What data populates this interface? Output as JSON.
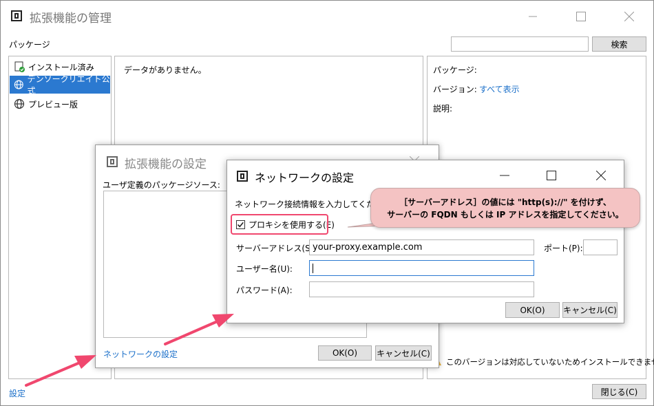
{
  "main_window": {
    "title": "拡張機能の管理",
    "packages_label": "パッケージ",
    "search_button": "検索",
    "sources": [
      {
        "label": "インストール済み",
        "icon": "installed-icon",
        "selected": false
      },
      {
        "label": "デンソークリエイト公式",
        "icon": "globe-icon",
        "selected": true
      },
      {
        "label": "プレビュー版",
        "icon": "globe-icon",
        "selected": false
      }
    ],
    "empty_message": "データがありません。",
    "detail": {
      "package_label": "パッケージ:",
      "version_label": "バージョン:",
      "show_all_link": "すべて表示",
      "description_label": "説明:",
      "warning_text": "このバージョンは対応していないためインストールできません。"
    },
    "settings_link": "設定",
    "close_button": "閉じる(C)"
  },
  "ext_settings": {
    "title": "拡張機能の設定",
    "user_sources_label": "ユーザ定義のパッケージソース:",
    "network_link": "ネットワークの設定",
    "ok_button": "OK(O)",
    "cancel_button": "キャンセル(C)"
  },
  "network_dialog": {
    "title": "ネットワークの設定",
    "instruction": "ネットワーク接続情報を入力してください。",
    "use_proxy_label": "プロキシを使用する(E)",
    "use_proxy_checked": true,
    "server_label": "サーバーアドレス(S):",
    "server_value": "your-proxy.example.com",
    "port_label": "ポート(P):",
    "port_value": "",
    "username_label": "ユーザー名(U):",
    "username_value": "",
    "password_label": "パスワード(A):",
    "password_value": "",
    "ok_button": "OK(O)",
    "cancel_button": "キャンセル(C)"
  },
  "callout": {
    "line1": "［サーバーアドレス］の値には \"http(s)://\" を付けず、",
    "line2": "サーバーの FQDN もしくは IP アドレスを指定してください。"
  },
  "colors": {
    "accent_blue": "#2b79d0",
    "link_blue": "#1a6fc9",
    "annotation_pink": "#f0476e",
    "callout_fill": "#f4c3c3"
  }
}
